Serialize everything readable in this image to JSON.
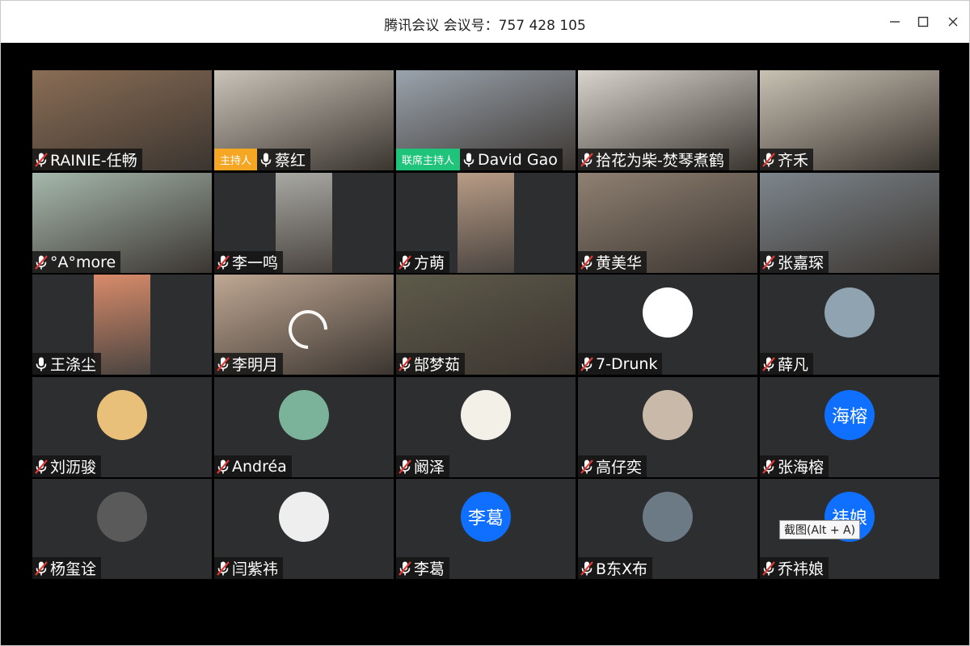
{
  "window": {
    "title": "腾讯会议 会议号：757 428 105"
  },
  "colors": {
    "host_badge": "#f5a623",
    "cohost_badge": "#1fc37a",
    "avatar_blue": "#0f6fff",
    "tile_bg": "#2d2e30"
  },
  "tooltip": "截图(Alt + A)",
  "participants": [
    {
      "name": "RAINIE-任畅",
      "role": "",
      "mic": "muted",
      "kind": "video",
      "bg": "#8a6d55"
    },
    {
      "name": "蔡红",
      "role": "主持人",
      "mic": "on",
      "kind": "video",
      "bg": "#c9c3b8"
    },
    {
      "name": "David Gao",
      "role": "联席主持人",
      "mic": "on",
      "kind": "video",
      "bg": "#9aa3ad"
    },
    {
      "name": "拾花为柴-焚琴煮鹤",
      "role": "",
      "mic": "muted",
      "kind": "video",
      "bg": "#d8d3cc"
    },
    {
      "name": "齐禾",
      "role": "",
      "mic": "muted",
      "kind": "video",
      "bg": "#c8c2b4"
    },
    {
      "name": "°A°more",
      "role": "",
      "mic": "muted",
      "kind": "video",
      "bg": "#a6b8ad"
    },
    {
      "name": "李一鸣",
      "role": "",
      "mic": "muted",
      "kind": "narrow",
      "bg": "#a8a8a3"
    },
    {
      "name": "方萌",
      "role": "",
      "mic": "muted",
      "kind": "narrow",
      "bg": "#b89c86"
    },
    {
      "name": "黄美华",
      "role": "",
      "mic": "muted",
      "kind": "video",
      "bg": "#8f8072"
    },
    {
      "name": "张嘉琛",
      "role": "",
      "mic": "muted",
      "kind": "video",
      "bg": "#7d868d"
    },
    {
      "name": "王涤尘",
      "role": "",
      "mic": "on",
      "kind": "narrow",
      "bg": "#d88b6a"
    },
    {
      "name": "李明月",
      "role": "",
      "mic": "muted",
      "kind": "video",
      "bg": "#bfa793",
      "spinner": true
    },
    {
      "name": "郜梦茹",
      "role": "",
      "mic": "muted",
      "kind": "video",
      "bg": "#5e5a4a"
    },
    {
      "name": "7-Drunk",
      "role": "",
      "mic": "muted",
      "kind": "avatar",
      "avatar_text": "",
      "bg": "#ffffff"
    },
    {
      "name": "薛凡",
      "role": "",
      "mic": "muted",
      "kind": "avatar",
      "avatar_text": "",
      "bg": "#8fa3b0"
    },
    {
      "name": "刘沥骏",
      "role": "",
      "mic": "muted",
      "kind": "avatar",
      "avatar_text": "",
      "bg": "#e8c07a"
    },
    {
      "name": "Andréa",
      "role": "",
      "mic": "muted",
      "kind": "avatar",
      "avatar_text": "",
      "bg": "#7bb39a"
    },
    {
      "name": "阚泽",
      "role": "",
      "mic": "muted",
      "kind": "avatar",
      "avatar_text": "",
      "bg": "#f3f0e8"
    },
    {
      "name": "高仔奕",
      "role": "",
      "mic": "muted",
      "kind": "avatar",
      "avatar_text": "",
      "bg": "#c9b9a8"
    },
    {
      "name": "张海榕",
      "role": "",
      "mic": "muted",
      "kind": "avatar",
      "avatar_text": "海榕",
      "bg": "#0f6fff"
    },
    {
      "name": "杨玺诠",
      "role": "",
      "mic": "muted",
      "kind": "avatar",
      "avatar_text": "",
      "bg": "#5a5a5a"
    },
    {
      "name": "闫紫祎",
      "role": "",
      "mic": "muted",
      "kind": "avatar",
      "avatar_text": "",
      "bg": "#eeeeee"
    },
    {
      "name": "李葛",
      "role": "",
      "mic": "muted",
      "kind": "avatar",
      "avatar_text": "李葛",
      "bg": "#0f6fff"
    },
    {
      "name": "B东X布",
      "role": "",
      "mic": "muted",
      "kind": "avatar",
      "avatar_text": "",
      "bg": "#6c7a86"
    },
    {
      "name": "乔祎娘",
      "role": "",
      "mic": "muted",
      "kind": "avatar",
      "avatar_text": "祎娘",
      "bg": "#0f6fff"
    }
  ]
}
